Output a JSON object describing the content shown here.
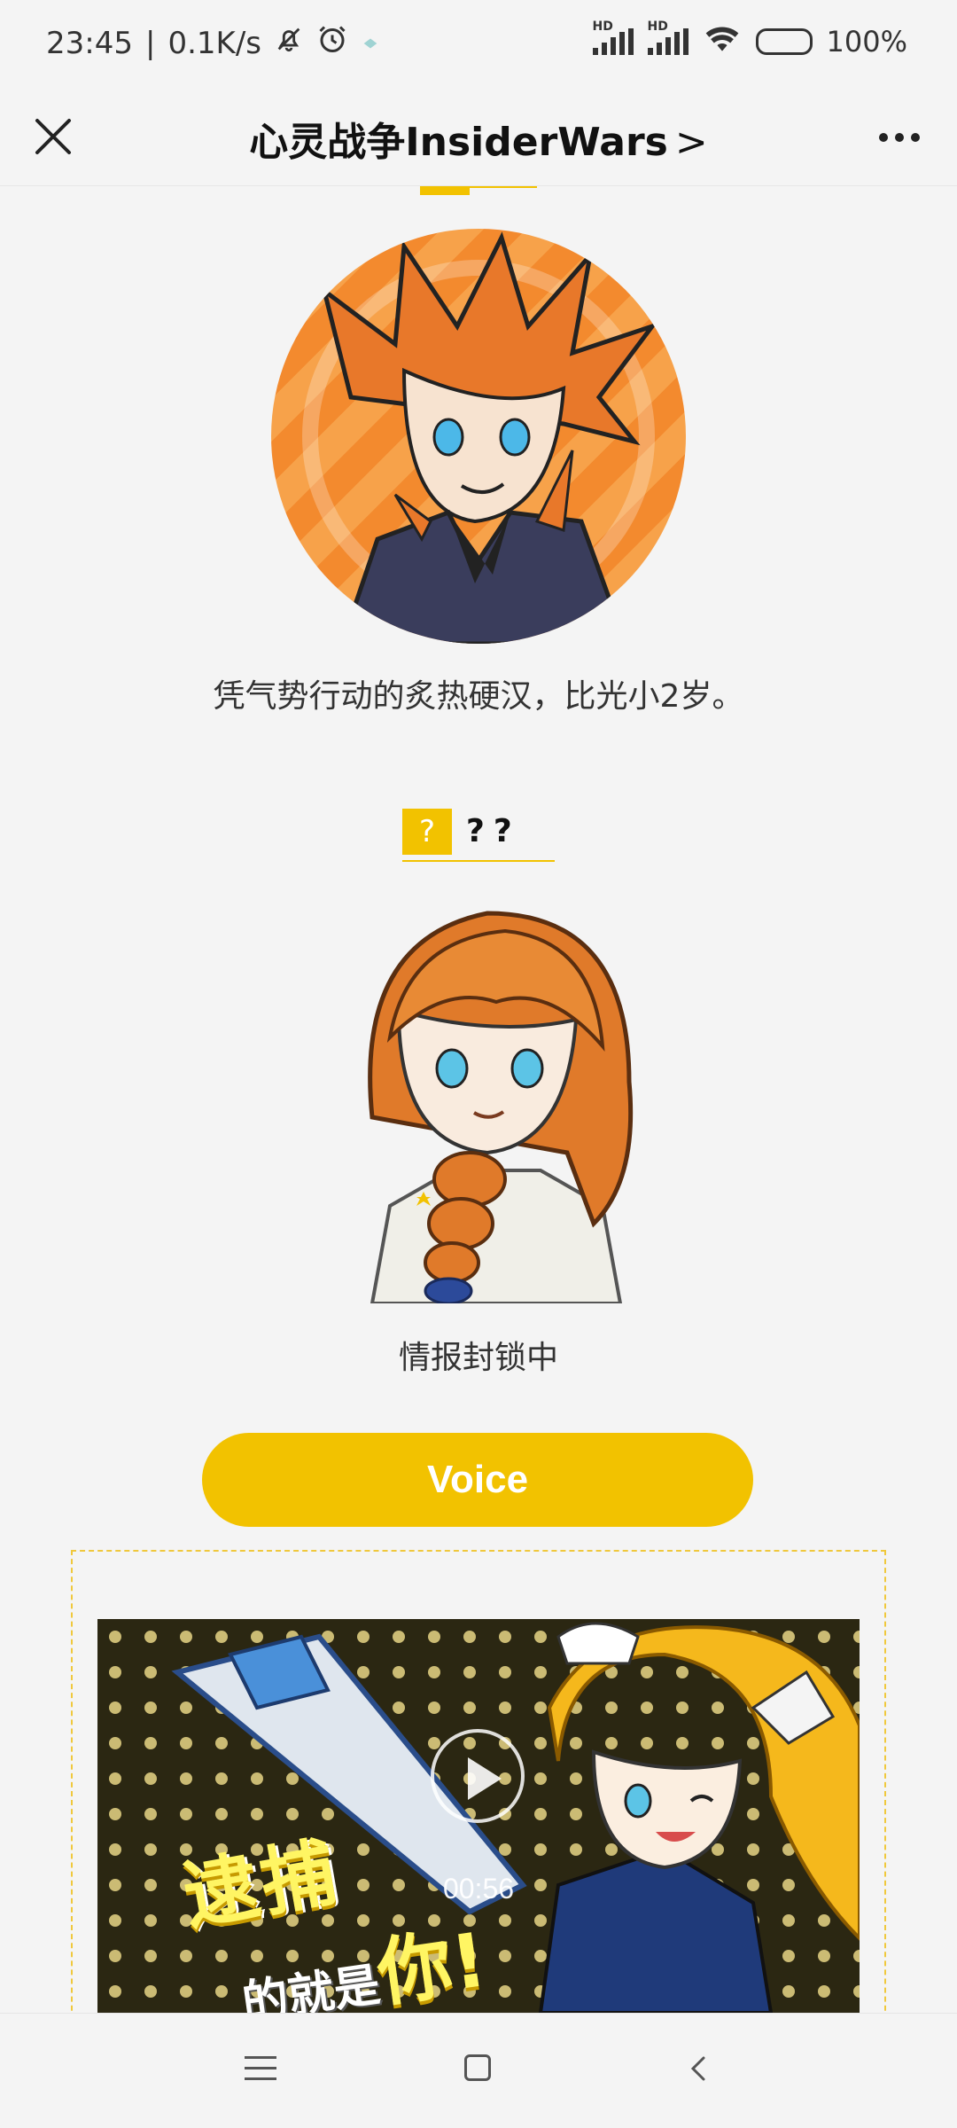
{
  "status_bar": {
    "time": "23:45",
    "net_speed": "0.1K/s",
    "signal_label_1": "HD",
    "signal_label_2": "HD",
    "battery": "100%"
  },
  "header": {
    "title": "心灵战争InsiderWars",
    "chevron": ">"
  },
  "characters": [
    {
      "description": "凭气势行动的炙热硬汉，比光小2岁。"
    },
    {
      "name_box": "?",
      "name": "??",
      "description": "情报封锁中"
    }
  ],
  "voice_button": {
    "label": "Voice"
  },
  "video": {
    "duration": "00:56",
    "caption_line1": "逮捕",
    "caption_line2_small": "的就是",
    "caption_line2_big": "你!"
  },
  "colors": {
    "accent": "#f2c200",
    "background": "#f4f4f4"
  }
}
